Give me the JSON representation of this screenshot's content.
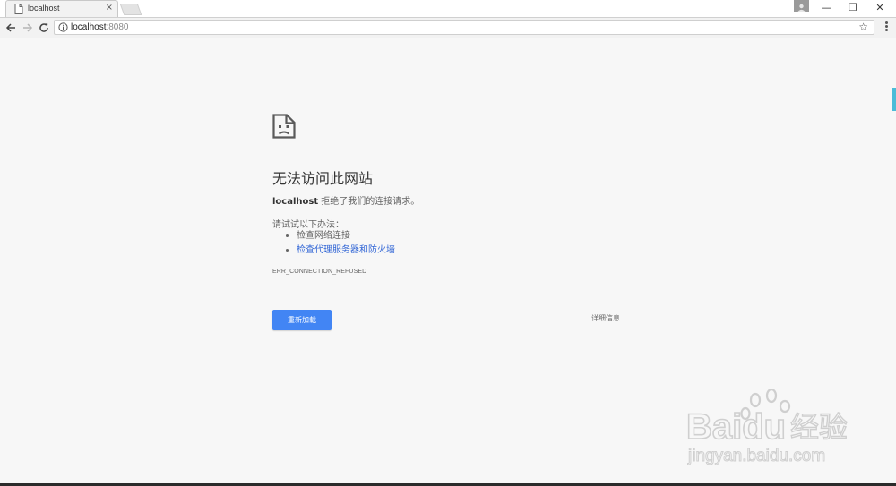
{
  "browser": {
    "tab": {
      "title": "localhost",
      "close_label": "×"
    },
    "window_controls": {
      "minimize": "—",
      "restore": "❐",
      "close": "✕"
    },
    "address": {
      "host": "localhost",
      "port": ":8080"
    },
    "icons": {
      "back": "back-arrow-icon",
      "forward": "forward-arrow-icon",
      "reload": "reload-icon",
      "info": "info-icon",
      "bookmark": "star-icon",
      "menu": "more-vert-icon"
    }
  },
  "error_page": {
    "heading": "无法访问此网站",
    "detail_host": "localhost",
    "detail_text": " 拒绝了我们的连接请求。",
    "suggest_intro": "请试试以下办法：",
    "suggestions": [
      {
        "label": "检查网络连接",
        "is_link": false
      },
      {
        "label": "检查代理服务器和防火墙",
        "is_link": true
      }
    ],
    "error_code": "ERR_CONNECTION_REFUSED",
    "reload_button": "重新加载",
    "details_button": "详细信息"
  },
  "watermark": {
    "brand": "Baidu",
    "brand_cn": "经验",
    "url": "jingyan.baidu.com"
  },
  "colors": {
    "accent": "#4285f4",
    "link": "#3367d6",
    "background": "#f7f7f7"
  }
}
